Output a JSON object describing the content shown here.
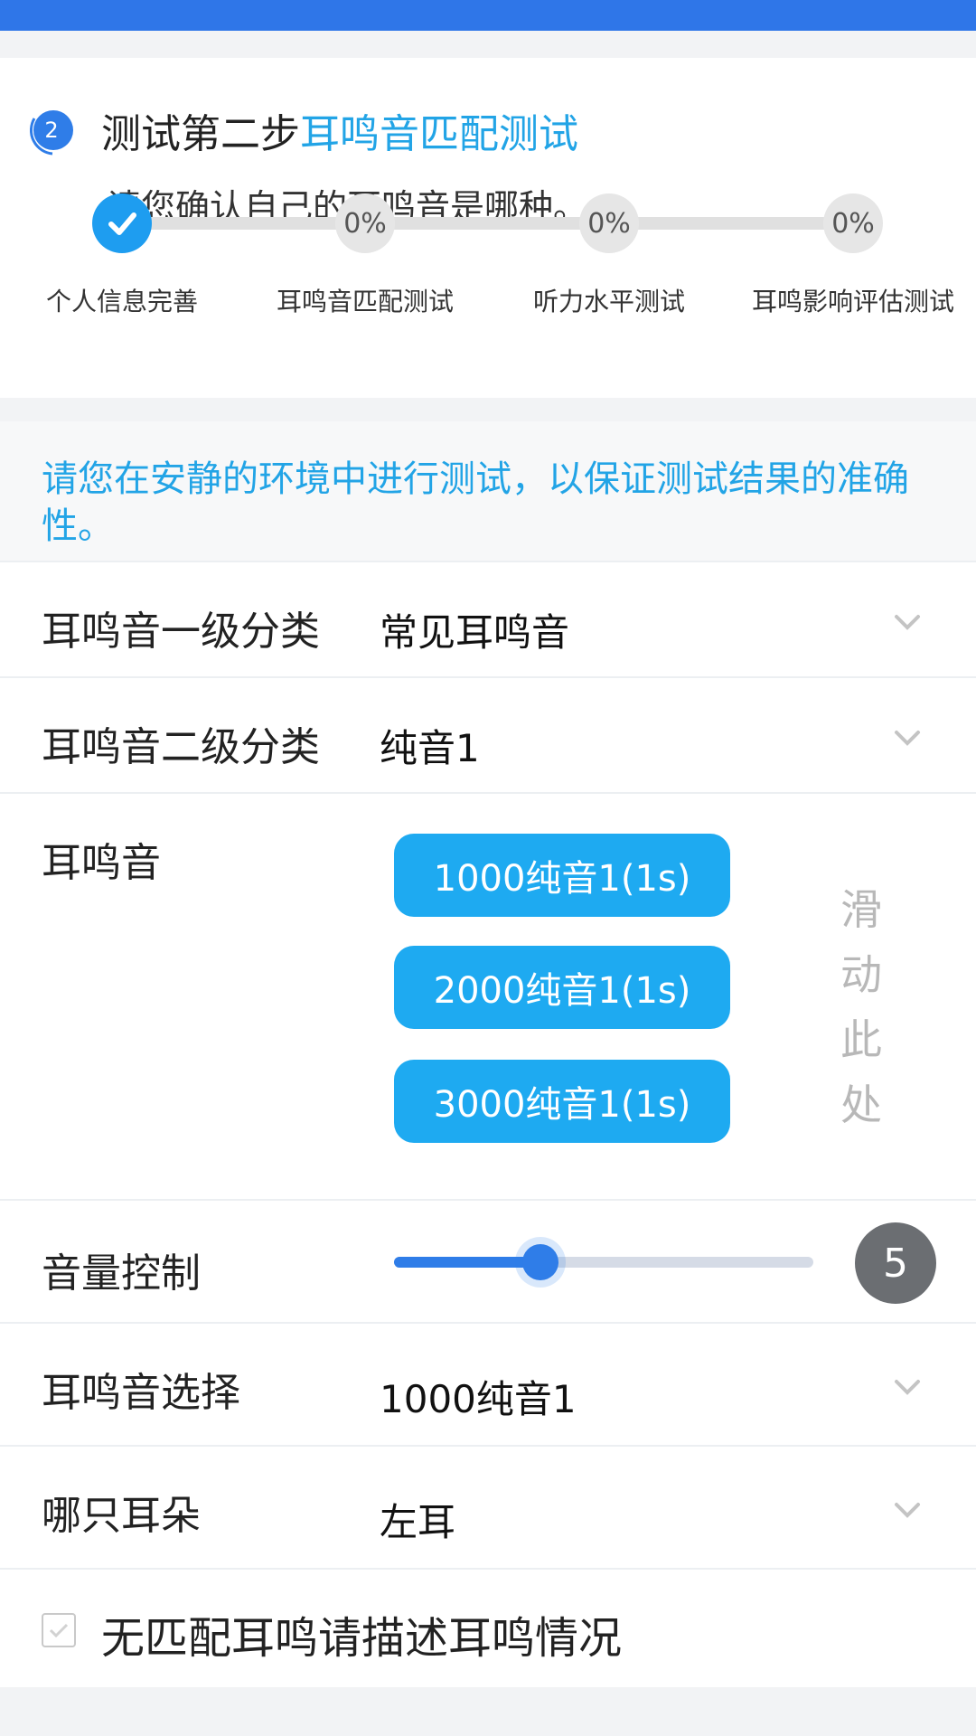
{
  "step": {
    "number": "2",
    "title_prefix": "测试第二步",
    "title_highlight": "耳鸣音匹配测试",
    "subtitle": "请您确认自己的耳鸣音是哪种。",
    "progress_nodes": [
      {
        "label": "个人信息完善",
        "percent": "",
        "done": true
      },
      {
        "label": "耳鸣音匹配测试",
        "percent": "0%",
        "done": false
      },
      {
        "label": "听力水平测试",
        "percent": "0%",
        "done": false
      },
      {
        "label": "耳鸣影响评估测试",
        "percent": "0%",
        "done": false
      }
    ]
  },
  "notice": "请您在安静的环境中进行测试，以保证测试结果的准确性。",
  "category1": {
    "label": "耳鸣音一级分类",
    "value": "常见耳鸣音"
  },
  "category2": {
    "label": "耳鸣音二级分类",
    "value": "纯音1"
  },
  "tinnitus": {
    "label": "耳鸣音",
    "options": [
      "1000纯音1(1s)",
      "2000纯音1(1s)",
      "3000纯音1(1s)"
    ],
    "scroll_hint": [
      "滑",
      "动",
      "此",
      "处"
    ]
  },
  "volume": {
    "label": "音量控制",
    "value": "5",
    "level_fraction": 0.35
  },
  "selection": {
    "label": "耳鸣音选择",
    "value": "1000纯音1"
  },
  "ear": {
    "label": "哪只耳朵",
    "value": "左耳"
  },
  "no_match": {
    "label": "无匹配耳鸣请描述耳鸣情况"
  },
  "colors": {
    "accent": "#22a4e6",
    "button": "#1eaaf1",
    "header": "#2f76e8"
  }
}
